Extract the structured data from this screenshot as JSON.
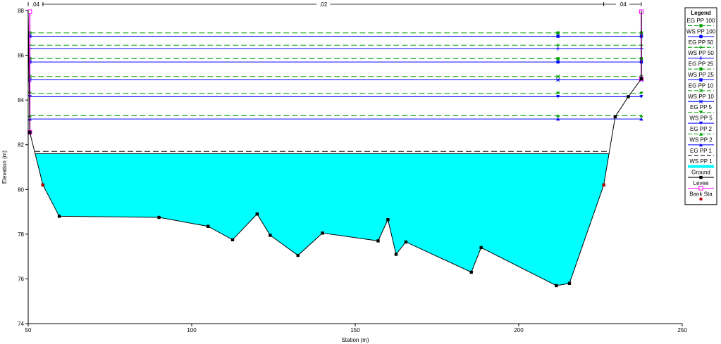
{
  "chart_data": {
    "type": "line",
    "xlabel": "Station (m)",
    "ylabel": "Elevation (m)",
    "xlim": [
      50,
      250
    ],
    "ylim": [
      74,
      88
    ],
    "x_ticks": [
      50,
      100,
      150,
      200,
      250
    ],
    "y_ticks": [
      74,
      76,
      78,
      80,
      82,
      84,
      86,
      88
    ],
    "grid": false,
    "legend_position": "right",
    "colors": {
      "water_fill": "#00ffff",
      "ground": "#000000",
      "eg": "#00a000",
      "ws": "#0000ff",
      "levee": "#ff00ff",
      "bank": "#c00000"
    },
    "mannings": [
      {
        "label": ".04",
        "from": 50,
        "to": 54.5
      },
      {
        "label": ".02",
        "from": 54.5,
        "to": 226
      },
      {
        "label": ".04",
        "from": 226,
        "to": 237.5
      }
    ],
    "ground": {
      "name": "Ground",
      "x": [
        50,
        50.5,
        54.5,
        59.5,
        90,
        105,
        112.5,
        120,
        124,
        132.5,
        140,
        157,
        160,
        162.5,
        165.5,
        185.5,
        188.5,
        211.5,
        215.5,
        226,
        229.5,
        233.5,
        237.5,
        237.5
      ],
      "y": [
        88,
        82.55,
        80.2,
        78.8,
        78.75,
        78.35,
        77.75,
        78.9,
        77.95,
        77.05,
        78.05,
        77.7,
        78.65,
        77.1,
        77.65,
        76.3,
        77.4,
        75.7,
        75.8,
        80.2,
        83.25,
        84.15,
        84.95,
        88
      ]
    },
    "levee": {
      "name": "Levee",
      "points": [
        {
          "x": 50.5,
          "y": 82.55
        },
        {
          "x": 50.5,
          "y": 87.95
        },
        {
          "x": 237.5,
          "y": 87.95
        },
        {
          "x": 237.5,
          "y": 84.95
        }
      ]
    },
    "bank_stations": {
      "name": "Bank Sta",
      "points": [
        {
          "x": 54.5,
          "y": 80.2
        },
        {
          "x": 226,
          "y": 80.2
        }
      ]
    },
    "profiles": [
      {
        "name": "EG PP 100",
        "kind": "eg",
        "y": 87.0,
        "marker": "square"
      },
      {
        "name": "WS PP 100",
        "kind": "ws",
        "y": 86.85,
        "marker": "square"
      },
      {
        "name": "EG PP 50",
        "kind": "eg",
        "y": 86.45,
        "marker": "plus"
      },
      {
        "name": "WS PP 50",
        "kind": "ws",
        "y": 86.3,
        "marker": "plus"
      },
      {
        "name": "EG PP 25",
        "kind": "eg",
        "y": 85.85,
        "marker": "square"
      },
      {
        "name": "WS PP 25",
        "kind": "ws",
        "y": 85.7,
        "marker": "square"
      },
      {
        "name": "EG PP 10",
        "kind": "eg",
        "y": 85.05,
        "marker": "x"
      },
      {
        "name": "WS PP 10",
        "kind": "ws",
        "y": 84.9,
        "marker": "x"
      },
      {
        "name": "EG PP 5",
        "kind": "eg",
        "y": 84.3,
        "marker": "triangle-down"
      },
      {
        "name": "WS PP 5",
        "kind": "ws",
        "y": 84.15,
        "marker": "triangle-down"
      },
      {
        "name": "EG PP 2",
        "kind": "eg",
        "y": 83.3,
        "marker": "triangle-up"
      },
      {
        "name": "WS PP 2",
        "kind": "ws",
        "y": 83.15,
        "marker": "triangle-up"
      },
      {
        "name": "EG PP 1",
        "kind": "eg-dash",
        "y": 81.7,
        "marker": "none"
      },
      {
        "name": "WS PP 1",
        "kind": "ws-fill",
        "y": 81.6,
        "marker": "none"
      }
    ],
    "legend": {
      "title": "Legend",
      "entries": [
        {
          "label": "EG PP 100",
          "kind": "eg",
          "marker": "square"
        },
        {
          "label": "WS PP 100",
          "kind": "ws",
          "marker": "square"
        },
        {
          "label": "EG PP 50",
          "kind": "eg",
          "marker": "plus"
        },
        {
          "label": "WS PP 50",
          "kind": "ws",
          "marker": "plus"
        },
        {
          "label": "EG PP 25",
          "kind": "eg",
          "marker": "square"
        },
        {
          "label": "WS PP 25",
          "kind": "ws",
          "marker": "square"
        },
        {
          "label": "EG PP 10",
          "kind": "eg",
          "marker": "x"
        },
        {
          "label": "WS PP 10",
          "kind": "ws",
          "marker": "x"
        },
        {
          "label": "EG PP 5",
          "kind": "eg",
          "marker": "triangle-down"
        },
        {
          "label": "WS PP 5",
          "kind": "ws",
          "marker": "triangle-down"
        },
        {
          "label": "EG PP 2",
          "kind": "eg",
          "marker": "triangle-up"
        },
        {
          "label": "WS PP 2",
          "kind": "ws",
          "marker": "triangle-up"
        },
        {
          "label": "EG PP 1",
          "kind": "eg-dash",
          "marker": "none"
        },
        {
          "label": "WS PP 1",
          "kind": "ws-fill",
          "marker": "none"
        },
        {
          "label": "Ground",
          "kind": "ground",
          "marker": "square"
        },
        {
          "label": "Levee",
          "kind": "levee",
          "marker": "open-square"
        },
        {
          "label": "Bank Sta",
          "kind": "bank",
          "marker": "dot"
        }
      ]
    }
  }
}
